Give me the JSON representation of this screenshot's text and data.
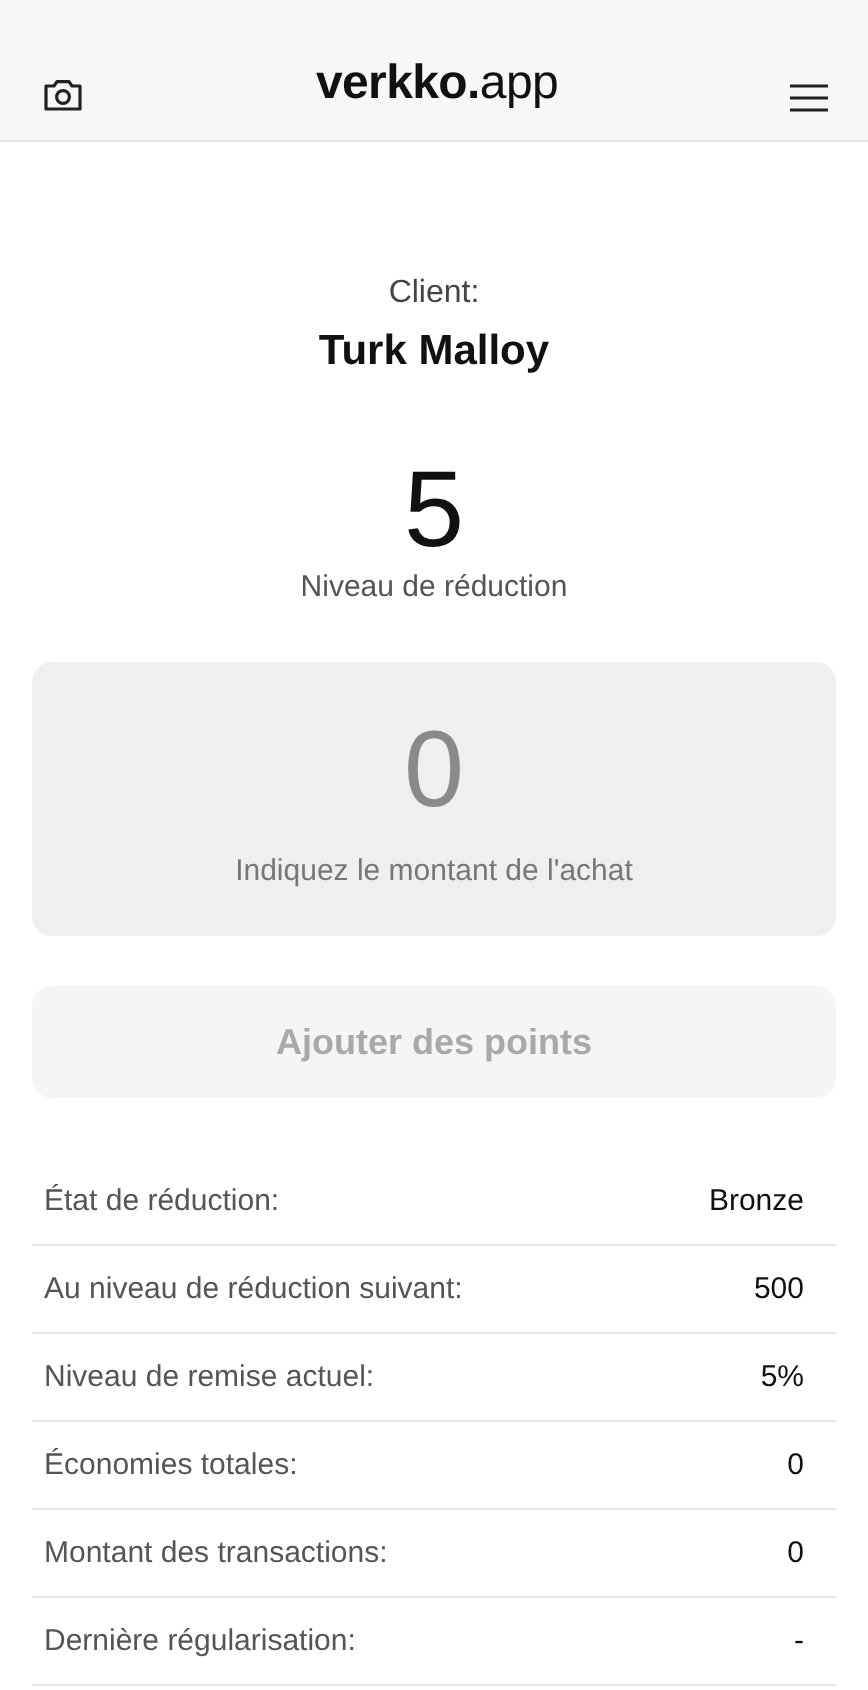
{
  "header": {
    "logo": "**verkko.**app"
  },
  "client": {
    "label": "Client:",
    "name": "Turk Malloy"
  },
  "level": {
    "value": "5",
    "label": "Niveau de réduction"
  },
  "amount": {
    "placeholder": "0",
    "hint": "Indiquez le montant de l'achat"
  },
  "add_button": {
    "label": "Ajouter des points",
    "disabled": true
  },
  "details": [
    {
      "label": "État de réduction:",
      "value": "Bronze"
    },
    {
      "label": "Au niveau de réduction suivant:",
      "value": "500"
    },
    {
      "label": "Niveau de remise actuel:",
      "value": "5%"
    },
    {
      "label": "Économies totales:",
      "value": "0"
    },
    {
      "label": "Montant des transactions:",
      "value": "0"
    },
    {
      "label": "Dernière régularisation:",
      "value": "-"
    }
  ]
}
